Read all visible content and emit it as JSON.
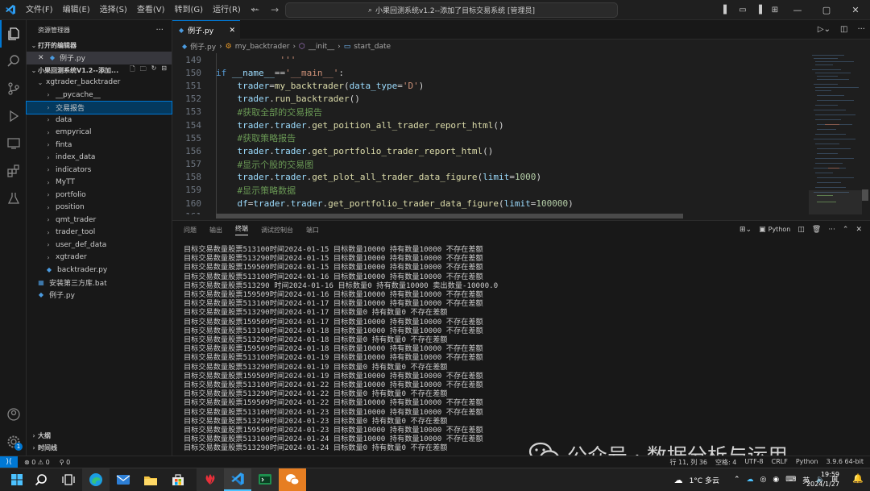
{
  "titlebar": {
    "menu": [
      "文件(F)",
      "编辑(E)",
      "选择(S)",
      "查看(V)",
      "转到(G)",
      "运行(R)",
      "···"
    ],
    "search_text": "小果回测系统v1.2--添加了目标交易系统 [管理员]",
    "window_controls": [
      "—",
      "▢",
      "✕"
    ]
  },
  "sidebar": {
    "title": "资源管理器",
    "open_editors_label": "打开的编辑器",
    "open_editor_file": "例子.py",
    "project_label": "小果回测系统V1.2--添加...",
    "root_folder": "xgtrader_backtrader",
    "items": [
      {
        "label": "__pycache__",
        "type": "folder",
        "indent": 2
      },
      {
        "label": "交易报告",
        "type": "folder",
        "indent": 2,
        "selected": true
      },
      {
        "label": "data",
        "type": "folder",
        "indent": 2
      },
      {
        "label": "empyrical",
        "type": "folder",
        "indent": 2
      },
      {
        "label": "finta",
        "type": "folder",
        "indent": 2
      },
      {
        "label": "index_data",
        "type": "folder",
        "indent": 2
      },
      {
        "label": "indicators",
        "type": "folder",
        "indent": 2
      },
      {
        "label": "MyTT",
        "type": "folder",
        "indent": 2
      },
      {
        "label": "portfolio",
        "type": "folder",
        "indent": 2
      },
      {
        "label": "position",
        "type": "folder",
        "indent": 2
      },
      {
        "label": "qmt_trader",
        "type": "folder",
        "indent": 2
      },
      {
        "label": "trader_tool",
        "type": "folder",
        "indent": 2
      },
      {
        "label": "user_def_data",
        "type": "folder",
        "indent": 2
      },
      {
        "label": "xgtrader",
        "type": "folder",
        "indent": 2
      },
      {
        "label": "backtrader.py",
        "type": "py",
        "indent": 2
      },
      {
        "label": "安装第三方库.bat",
        "type": "bat",
        "indent": 1
      },
      {
        "label": "例子.py",
        "type": "py",
        "indent": 1
      }
    ],
    "outline_label": "大纲",
    "timeline_label": "时间线"
  },
  "editor": {
    "tab_label": "例子.py",
    "breadcrumb": [
      "例子.py",
      "my_backtrader",
      "__init__",
      "start_date"
    ],
    "lines": [
      {
        "n": "149",
        "html": "            <span class=\"st\">'''</span>"
      },
      {
        "n": "150",
        "html": "<span class=\"kw\">if</span> <span class=\"vr\">__name__</span><span class=\"op\">==</span><span class=\"st\">'__main__'</span><span class=\"op\">:</span>"
      },
      {
        "n": "151",
        "html": "    <span class=\"vr\">trader</span><span class=\"op\">=</span><span class=\"fn\">my_backtrader</span><span class=\"op\">(</span><span class=\"vr\">data_type</span><span class=\"op\">=</span><span class=\"st\">'D'</span><span class=\"op\">)</span>"
      },
      {
        "n": "152",
        "html": "    <span class=\"vr\">trader</span><span class=\"op\">.</span><span class=\"fn\">run_backtrader</span><span class=\"op\">()</span>"
      },
      {
        "n": "153",
        "html": "    <span class=\"cm\">#获取全部的交易报告</span>"
      },
      {
        "n": "154",
        "html": "    <span class=\"vr\">trader</span><span class=\"op\">.</span><span class=\"vr\">trader</span><span class=\"op\">.</span><span class=\"fn\">get_poition_all_trader_report_html</span><span class=\"op\">()</span>"
      },
      {
        "n": "155",
        "html": "    <span class=\"cm\">#获取策略报告</span>"
      },
      {
        "n": "156",
        "html": "    <span class=\"vr\">trader</span><span class=\"op\">.</span><span class=\"vr\">trader</span><span class=\"op\">.</span><span class=\"fn\">get_portfolio_trader_report_html</span><span class=\"op\">()</span>"
      },
      {
        "n": "157",
        "html": "    <span class=\"cm\">#显示个股的交易图</span>"
      },
      {
        "n": "158",
        "html": "    <span class=\"vr\">trader</span><span class=\"op\">.</span><span class=\"vr\">trader</span><span class=\"op\">.</span><span class=\"fn\">get_plot_all_trader_data_figure</span><span class=\"op\">(</span><span class=\"vr\">limit</span><span class=\"op\">=</span><span class=\"nm\">1000</span><span class=\"op\">)</span>"
      },
      {
        "n": "159",
        "html": "    <span class=\"cm\">#显示策略数据</span>"
      },
      {
        "n": "160",
        "html": "    <span class=\"vr\">df</span><span class=\"op\">=</span><span class=\"vr\">trader</span><span class=\"op\">.</span><span class=\"vr\">trader</span><span class=\"op\">.</span><span class=\"fn\">get_portfolio_trader_data_figure</span><span class=\"op\">(</span><span class=\"vr\">limit</span><span class=\"op\">=</span><span class=\"nm\">100000</span><span class=\"op\">)</span>"
      },
      {
        "n": "161",
        "html": ""
      }
    ]
  },
  "panel": {
    "tabs": [
      "问题",
      "输出",
      "终端",
      "调试控制台",
      "端口"
    ],
    "active_tab": "终端",
    "python_label": "Python",
    "terminal_lines": [
      "目标交易数量股票513100时间2024-01-15 目标数量10000 持有数量10000 不存在差额",
      "目标交易数量股票513290时间2024-01-15 目标数量10000 持有数量10000 不存在差额",
      "目标交易数量股票159509时间2024-01-15 目标数量10000 持有数量10000 不存在差额",
      "目标交易数量股票513100时间2024-01-16 目标数量10000 持有数量10000 不存在差额",
      "目标交易数量股票513290 时间2024-01-16 目标数量0 持有数量10000 卖出数量-10000.0",
      "目标交易数量股票159509时间2024-01-16 目标数量10000 持有数量10000 不存在差额",
      "目标交易数量股票513100时间2024-01-17 目标数量10000 持有数量10000 不存在差额",
      "目标交易数量股票513290时间2024-01-17 目标数量0 持有数量0 不存在差额",
      "目标交易数量股票159509时间2024-01-17 目标数量10000 持有数量10000 不存在差额",
      "目标交易数量股票513100时间2024-01-18 目标数量10000 持有数量10000 不存在差额",
      "目标交易数量股票513290时间2024-01-18 目标数量0 持有数量0 不存在差额",
      "目标交易数量股票159509时间2024-01-18 目标数量10000 持有数量10000 不存在差额",
      "目标交易数量股票513100时间2024-01-19 目标数量10000 持有数量10000 不存在差额",
      "目标交易数量股票513290时间2024-01-19 目标数量0 持有数量0 不存在差额",
      "目标交易数量股票159509时间2024-01-19 目标数量10000 持有数量10000 不存在差额",
      "目标交易数量股票513100时间2024-01-22 目标数量10000 持有数量10000 不存在差额",
      "目标交易数量股票513290时间2024-01-22 目标数量0 持有数量0 不存在差额",
      "目标交易数量股票159509时间2024-01-22 目标数量10000 持有数量10000 不存在差额",
      "目标交易数量股票513100时间2024-01-23 目标数量10000 持有数量10000 不存在差额",
      "目标交易数量股票513290时间2024-01-23 目标数量0 持有数量0 不存在差额",
      "目标交易数量股票159509时间2024-01-23 目标数量10000 持有数量10000 不存在差额",
      "目标交易数量股票513100时间2024-01-24 目标数量10000 持有数量10000 不存在差额",
      "目标交易数量股票513290时间2024-01-24 目标数量0 持有数量0 不存在差额"
    ]
  },
  "statusbar": {
    "errors": "⊗ 0 ⚠ 0",
    "ports": "⚲ 0",
    "right_items": [
      "行 11, 列 36",
      "空格: 4",
      "UTF-8",
      "CRLF",
      "Python",
      "3.9.6 64-bit"
    ]
  },
  "watermark": {
    "text": "公众号 · 数据分析与运用"
  },
  "taskbar": {
    "weather": "1°C 多云",
    "lang": "英",
    "time": "19:59",
    "date": "2024/1/27",
    "notification_count": "1"
  },
  "colors": {
    "accent": "#0078d4",
    "editor_bg": "#1e1e1e",
    "sidebar_bg": "#181818"
  }
}
